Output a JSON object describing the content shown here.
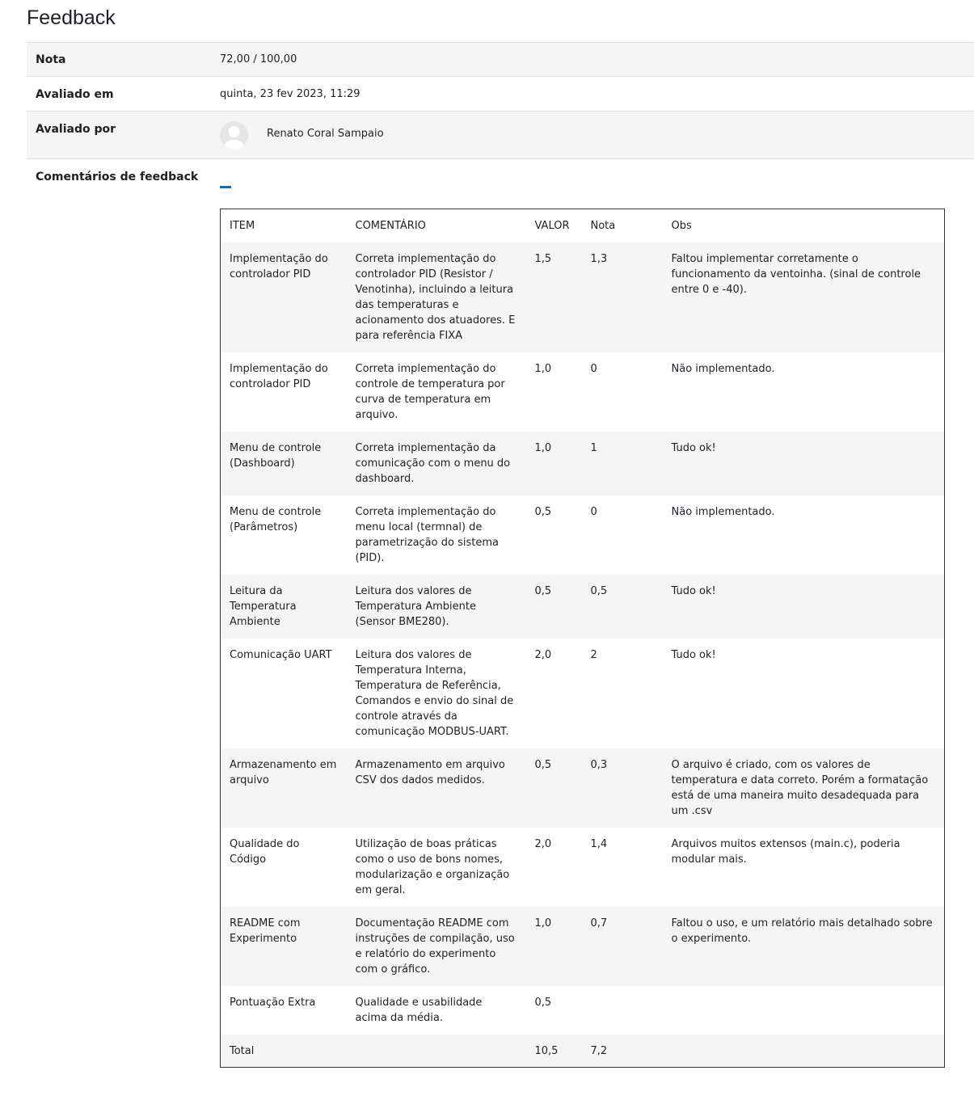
{
  "page": {
    "title": "Feedback"
  },
  "feedback": {
    "grade_label": "Nota",
    "grade_value": "72,00 / 100,00",
    "graded_on_label": "Avaliado em",
    "graded_on_value": "quinta, 23 fev 2023, 11:29",
    "graded_by_label": "Avaliado por",
    "grader_name": "Renato Coral Sampaio",
    "grader_avatar_icon": "user-avatar-icon",
    "comments_label": "Comentários de feedback",
    "collapse_icon": "collapse-minus-icon",
    "accent_color": "#0f6cbf"
  },
  "rubric": {
    "headers": [
      "ITEM",
      "COMENTÁRIO",
      "VALOR",
      "Nota",
      "Obs"
    ],
    "rows": [
      {
        "item": "Implementação do controlador PID",
        "comment": "Correta implementação do controlador PID (Resistor / Venotinha), incluindo a leitura das temperaturas e acionamento dos atuadores. E para referência FIXA",
        "value": "1,5",
        "grade": "1,3",
        "obs": "Faltou implementar corretamente o funcionamento da ventoinha. (sinal de controle entre 0 e -40)."
      },
      {
        "item": "Implementação do controlador PID",
        "comment": "Correta implementação do controle de temperatura por curva de temperatura em arquivo.",
        "value": "1,0",
        "grade": "0",
        "obs": "Não implementado."
      },
      {
        "item": "Menu de controle (Dashboard)",
        "comment": "Correta implementação da comunicação com o menu do dashboard.",
        "value": "1,0",
        "grade": "1",
        "obs": "Tudo ok!"
      },
      {
        "item": "Menu de controle (Parâmetros)",
        "comment": "Correta implementação do menu local (termnal) de parametrização do sistema (PID).",
        "value": "0,5",
        "grade": "0",
        "obs": "Não implementado."
      },
      {
        "item": "Leitura da Temperatura Ambiente",
        "comment": "Leitura dos valores de Temperatura Ambiente (Sensor BME280).",
        "value": "0,5",
        "grade": "0,5",
        "obs": "Tudo ok!"
      },
      {
        "item": "Comunicação UART",
        "comment": "Leitura dos valores de Temperatura Interna, Temperatura de Referência, Comandos e envio do sinal de controle através da comunicação MODBUS-UART.",
        "value": "2,0",
        "grade": "2",
        "obs": "Tudo ok!"
      },
      {
        "item": "Armazenamento em arquivo",
        "comment": "Armazenamento em arquivo CSV dos dados medidos.",
        "value": "0,5",
        "grade": "0,3",
        "obs": "O arquivo é criado, com os valores de temperatura e data correto. Porém a formatação está de uma maneira muito desadequada para um .csv"
      },
      {
        "item": "Qualidade do Código",
        "comment": "Utilização de boas práticas como o uso de bons nomes, modularização e organização em geral.",
        "value": "2,0",
        "grade": "1,4",
        "obs": "Arquivos muitos extensos (main.c), poderia modular mais."
      },
      {
        "item": "README com Experimento",
        "comment": "Documentação README com instruções de compilação, uso e relatório do experimento com o gráfico.",
        "value": "1,0",
        "grade": "0,7",
        "obs": "Faltou o uso, e um relatório mais detalhado sobre o experimento."
      },
      {
        "item": "Pontuação Extra",
        "comment": "Qualidade e usabilidade acima da média.",
        "value": "0,5",
        "grade": "",
        "obs": ""
      },
      {
        "item": "Total",
        "comment": "",
        "value": "10,5",
        "grade": "7,2",
        "obs": ""
      }
    ]
  }
}
